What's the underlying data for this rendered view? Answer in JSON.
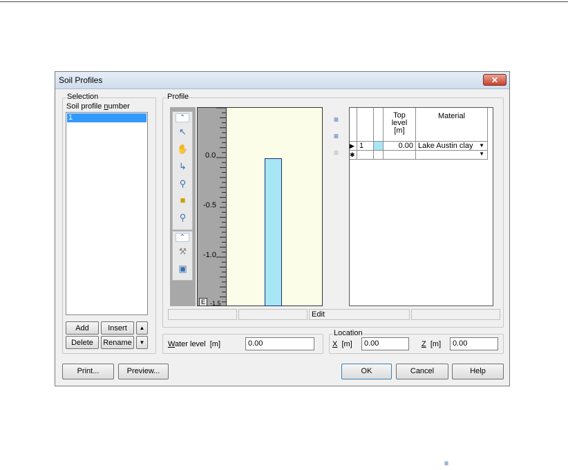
{
  "dialog": {
    "title": "Soil Profiles",
    "close_glyph": "✕"
  },
  "selection": {
    "group_label": "Selection",
    "list_label": "Soil profile number",
    "items": [
      "1"
    ],
    "selected": "1",
    "buttons": {
      "add": "Add",
      "insert": "Insert",
      "delete": "Delete",
      "rename": "Rename",
      "up": "▲",
      "down": "▼"
    }
  },
  "profile": {
    "group_label": "Profile",
    "toolbar_icons": [
      "collapse-icon",
      "pointer-icon",
      "pan-hand-icon",
      "link-nodes-icon",
      "zoom-in-icon",
      "ruler-icon",
      "zoom-window-icon",
      "collapse-icon",
      "wrench-icon",
      "properties-icon"
    ],
    "ruler": {
      "tick_labels": [
        "0.0",
        "-0.5",
        "-1.0",
        "-1.5"
      ],
      "axis_mark": "E"
    },
    "status": {
      "center": "Edit"
    },
    "row_tools": [
      "insert-row-icon",
      "add-row-icon",
      "delete-row-icon"
    ],
    "table": {
      "columns": [
        "Top level [m]",
        "Material"
      ],
      "col_top_level": {
        "line1": "Top",
        "line2": "level",
        "line3": "[m]"
      },
      "col_material": "Material",
      "rows": [
        {
          "num": "1",
          "top_level": "0.00",
          "material": "Lake Austin clay"
        }
      ],
      "new_row_marker": "✱",
      "current_row_marker": "▶"
    }
  },
  "chart_data": {
    "type": "bar",
    "title": "",
    "ylabel": "",
    "ylim": [
      -1.5,
      0.5
    ],
    "layer": {
      "top": 0.0,
      "bottom": -1.5,
      "material": "Lake Austin clay",
      "color": "#a7e6f4"
    }
  },
  "water_level": {
    "label_prefix": "W",
    "label_rest": "ater level",
    "unit": "[m]",
    "value": "0.00"
  },
  "location": {
    "group_label": "Location",
    "x_label": "X",
    "x_unit": "[m]",
    "x_value": "0.00",
    "z_label": "Z",
    "z_unit": "[m]",
    "z_value": "0.00"
  },
  "footer": {
    "print": "Print...",
    "preview": "Preview...",
    "ok": "OK",
    "cancel": "Cancel",
    "help": "Help"
  },
  "colors": {
    "selection": "#3399ff",
    "plot_bg": "#fbfde8",
    "layer_fill": "#a7e6f4",
    "layer_border": "#1b2b77"
  },
  "floating_icon": "add-row-icon"
}
